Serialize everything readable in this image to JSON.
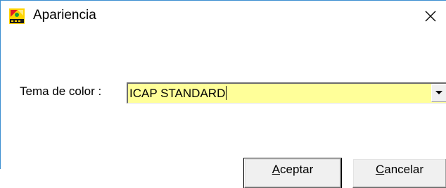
{
  "window": {
    "title": "Apariencia",
    "app_icon": "set-logo-icon",
    "close_icon": "close-icon"
  },
  "form": {
    "label": "Tema de color :",
    "theme_value": "ICAP STANDARD",
    "dropdown_icon": "chevron-down-icon"
  },
  "buttons": {
    "accept_mnemonic": "A",
    "accept_rest": "ceptar",
    "cancel_mnemonic": "C",
    "cancel_rest": "ancelar"
  },
  "colors": {
    "combo_background": "#ffff99",
    "button_face": "#f0f0f0",
    "window_border": "#3c8fd1"
  }
}
